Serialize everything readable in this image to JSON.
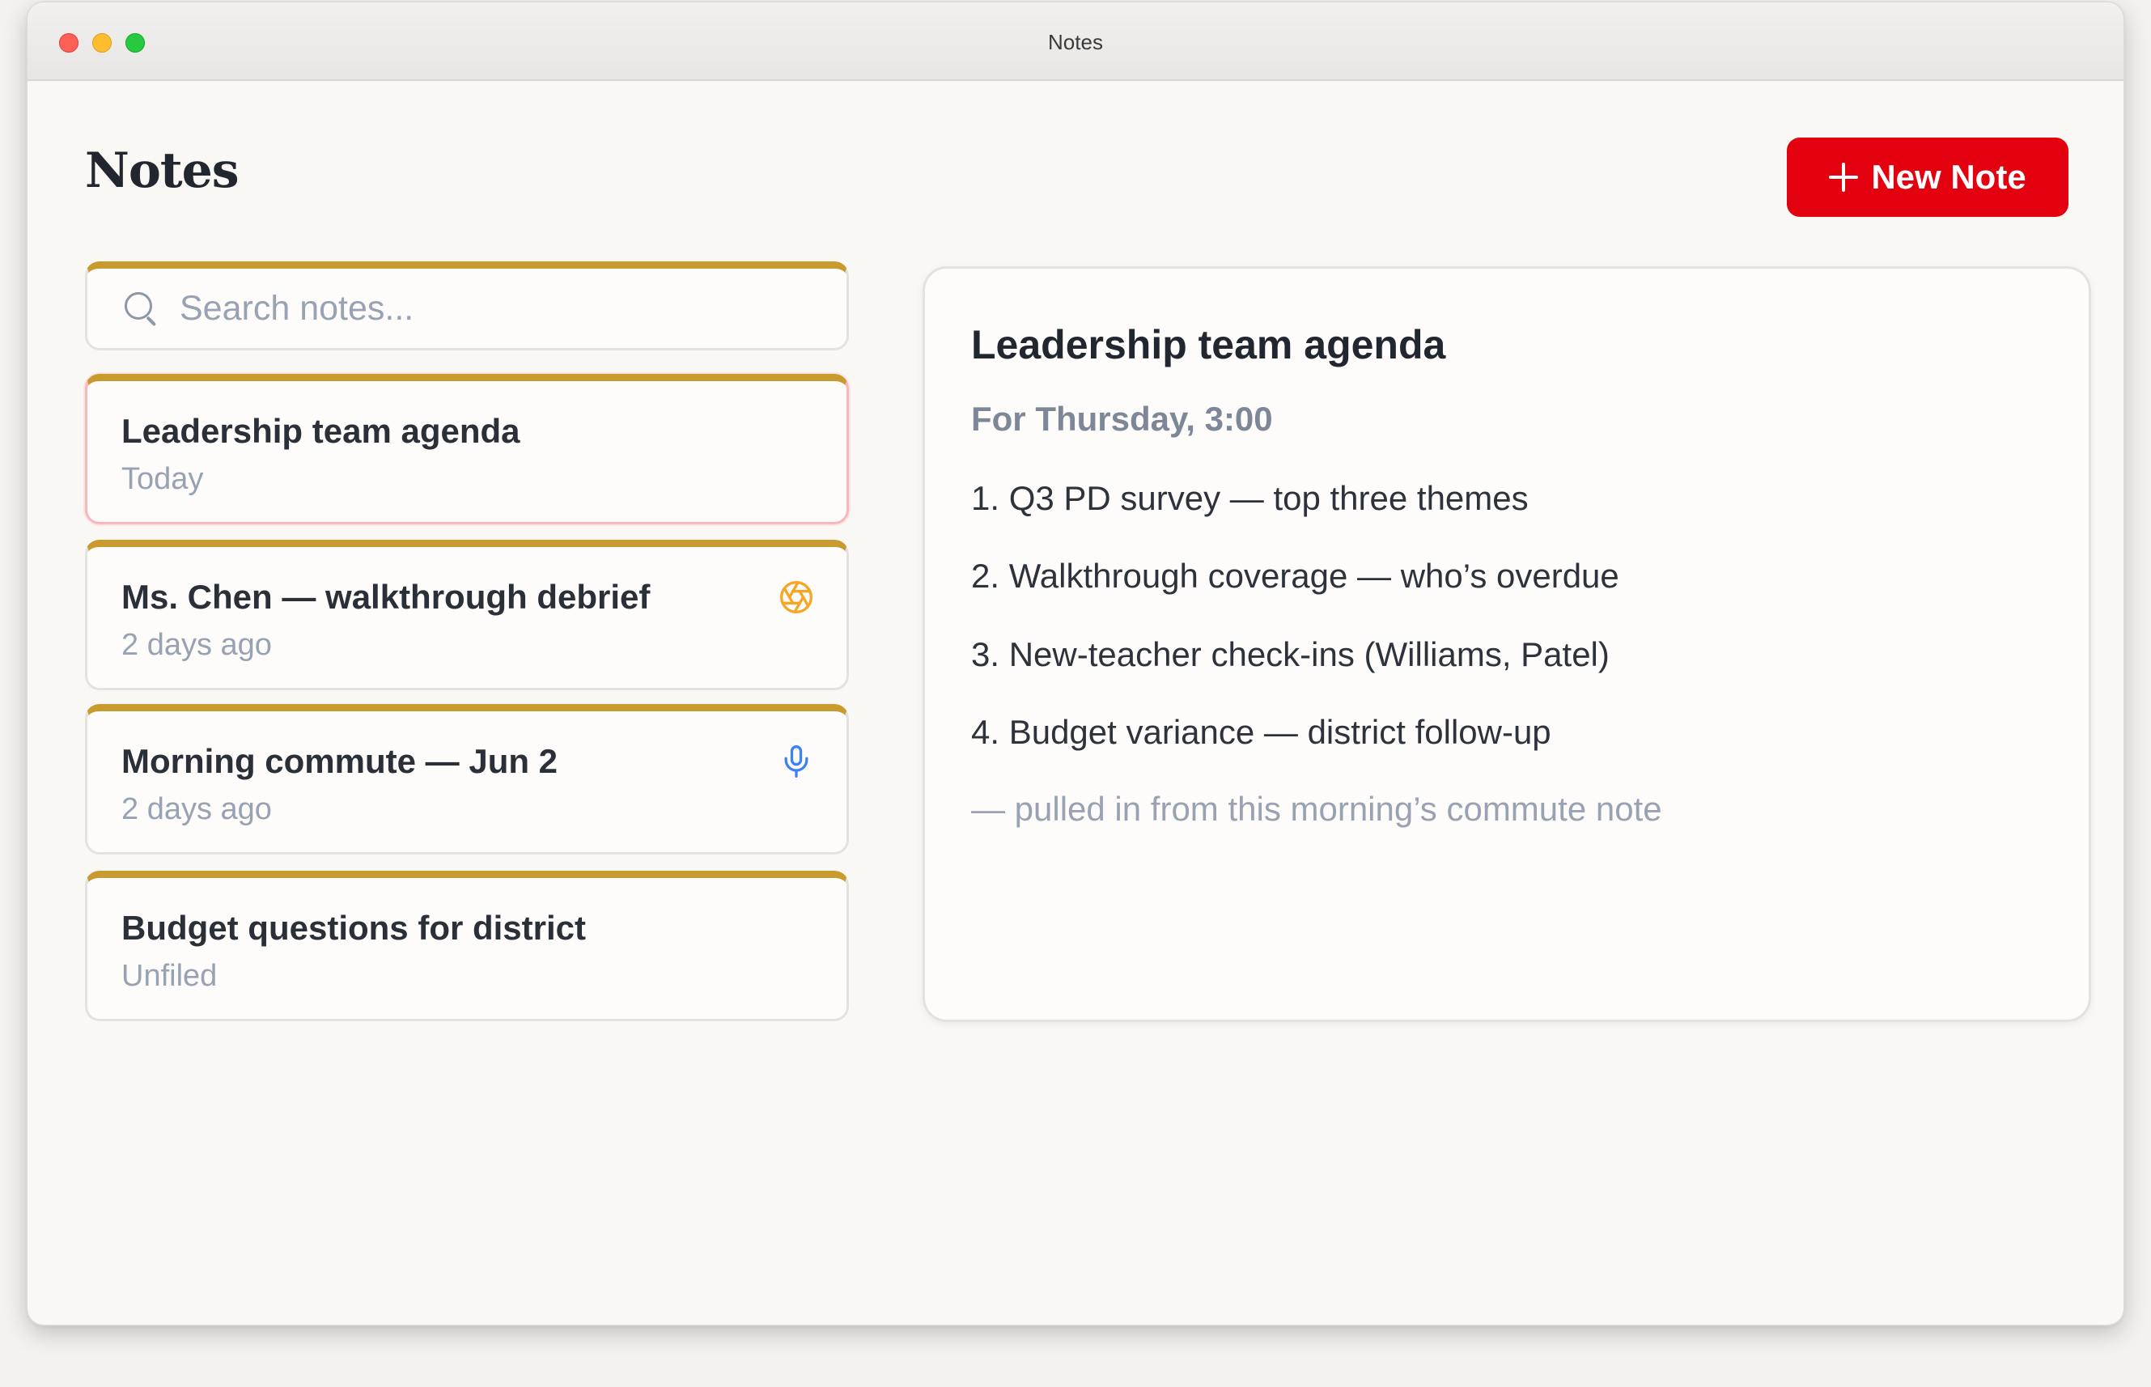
{
  "window": {
    "title": "Notes"
  },
  "header": {
    "title": "Notes",
    "new_note_label": "New Note"
  },
  "search": {
    "placeholder": "Search notes...",
    "value": ""
  },
  "notes": [
    {
      "title": "Leadership team agenda",
      "date": "Today",
      "selected": true,
      "icon": ""
    },
    {
      "title": "Ms. Chen — walkthrough debrief",
      "date": "2 days ago",
      "selected": false,
      "icon": "camera-aperture-icon"
    },
    {
      "title": "Morning commute — Jun 2",
      "date": "2 days ago",
      "selected": false,
      "icon": "microphone-icon"
    },
    {
      "title": "Budget questions for district",
      "date": "Unfiled",
      "selected": false,
      "icon": ""
    }
  ],
  "detail": {
    "title": "Leadership team agenda",
    "subtitle": "For Thursday, 3:00",
    "lines": [
      "1. Q3 PD survey — top three themes",
      "2. Walkthrough coverage — who’s overdue",
      "3. New-teacher check-ins (Williams, Patel)",
      "4. Budget variance — district follow-up"
    ],
    "footnote": "— pulled in from this morning’s commute note"
  },
  "colors": {
    "accent_red": "#e3000f",
    "card_top_gold": "#c99a2e",
    "selected_border": "#f7b7bb",
    "aperture_icon": "#f5a623",
    "mic_icon": "#3b82f6"
  }
}
